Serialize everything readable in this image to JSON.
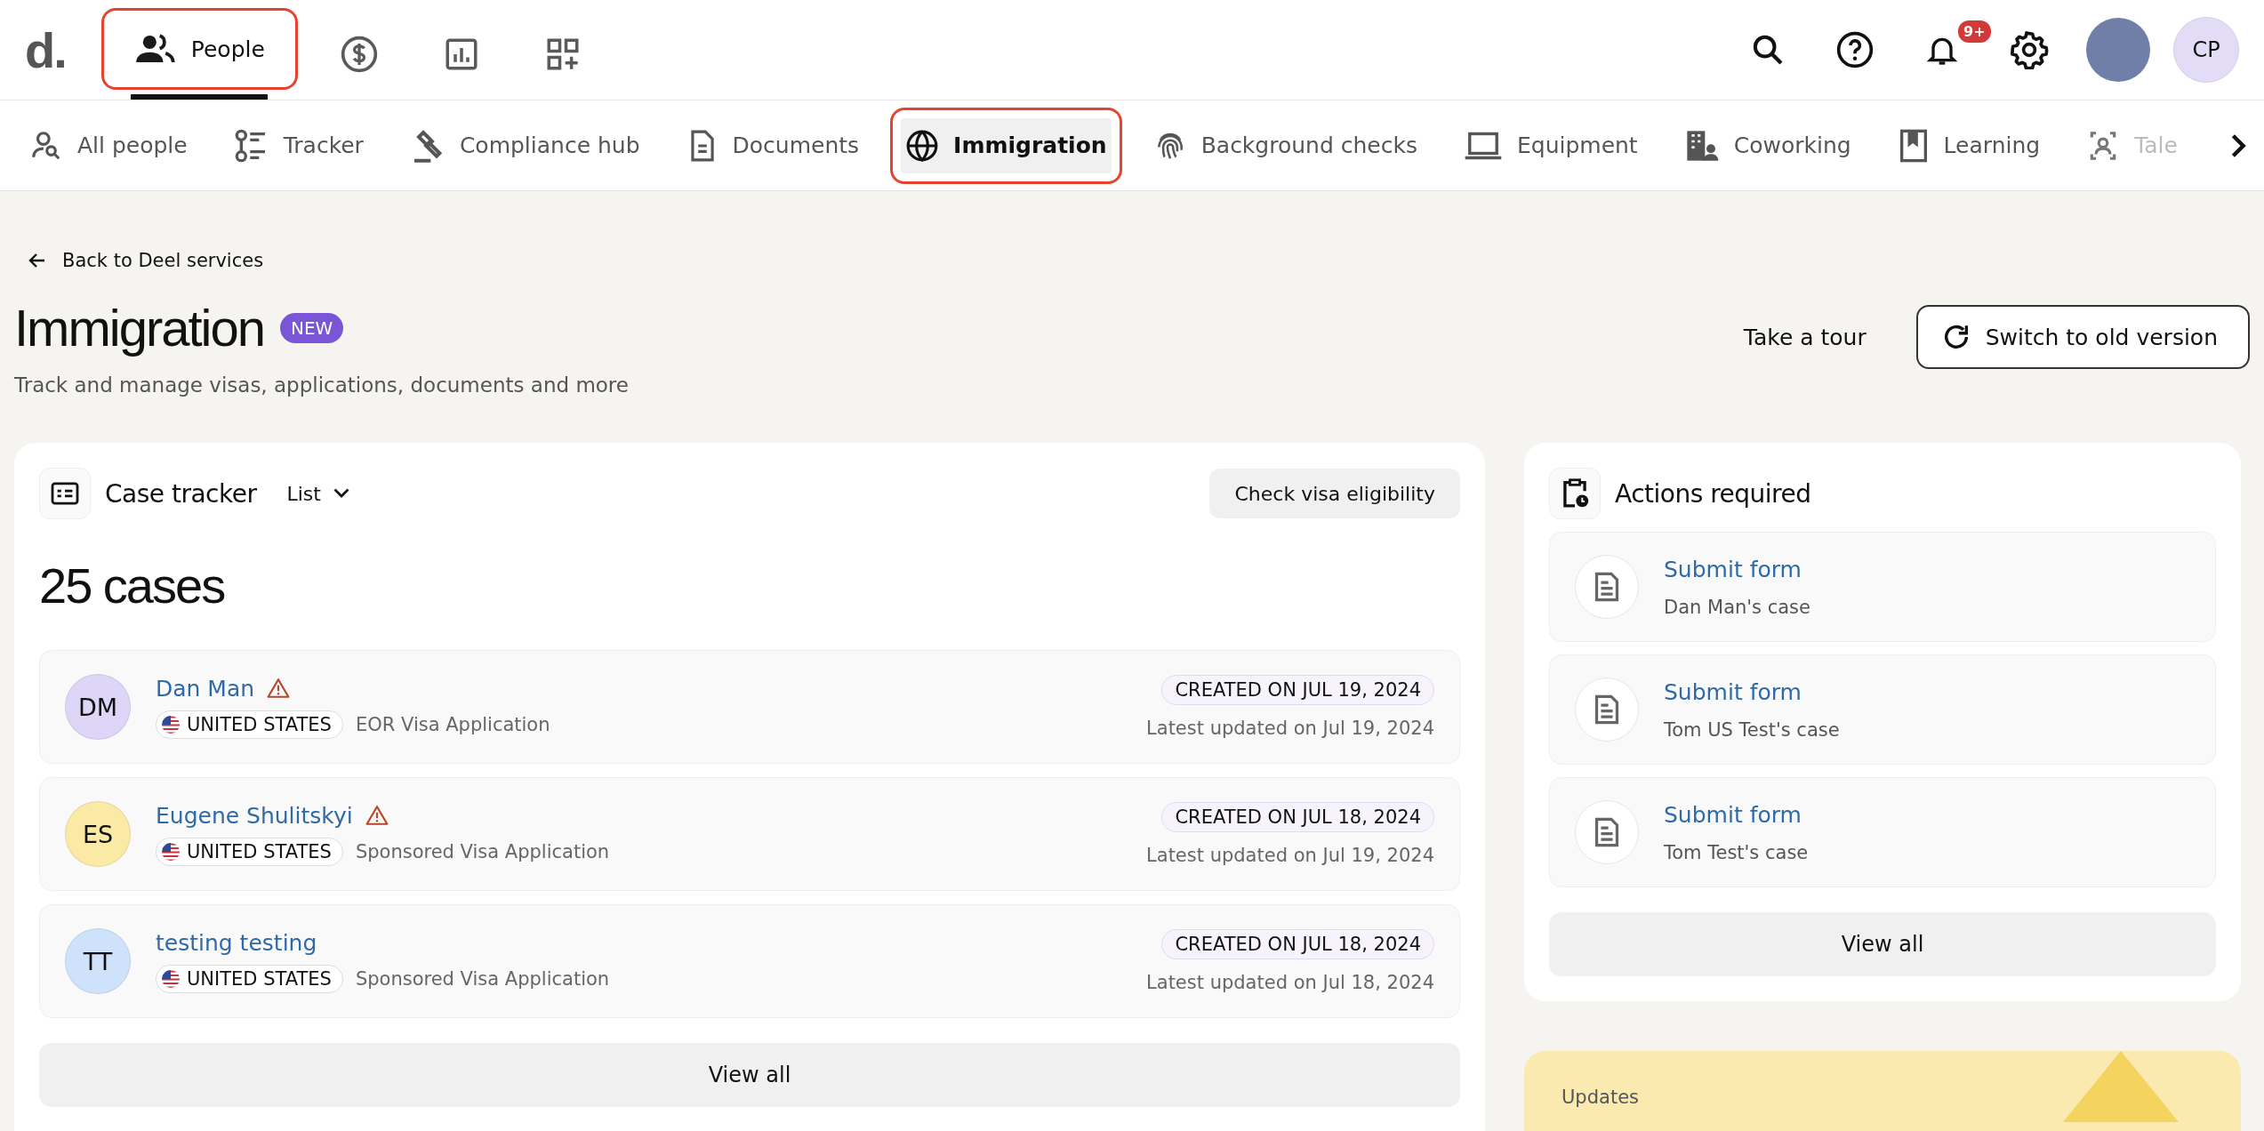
{
  "topbar": {
    "logo": "d.",
    "nav": [
      {
        "kind": "people",
        "label": "People",
        "selected": true,
        "highlighted": true
      },
      {
        "kind": "money",
        "selected": false,
        "highlighted": false
      },
      {
        "kind": "reports",
        "selected": false,
        "highlighted": false
      },
      {
        "kind": "apps",
        "selected": false,
        "highlighted": false
      }
    ],
    "notification_badge": "9+",
    "user_initials": "CP"
  },
  "tabs": [
    {
      "kind": "people-search",
      "label": "All people",
      "selected": false,
      "highlighted": false
    },
    {
      "kind": "tracker",
      "label": "Tracker",
      "selected": false,
      "highlighted": false
    },
    {
      "kind": "gavel",
      "label": "Compliance hub",
      "selected": false,
      "highlighted": false
    },
    {
      "kind": "document",
      "label": "Documents",
      "selected": false,
      "highlighted": false
    },
    {
      "kind": "globe",
      "label": "Immigration",
      "selected": true,
      "highlighted": true
    },
    {
      "kind": "fingerprint",
      "label": "Background checks",
      "selected": false,
      "highlighted": false
    },
    {
      "kind": "laptop",
      "label": "Equipment",
      "selected": false,
      "highlighted": false
    },
    {
      "kind": "building",
      "label": "Coworking",
      "selected": false,
      "highlighted": false
    },
    {
      "kind": "book",
      "label": "Learning",
      "selected": false,
      "highlighted": false
    },
    {
      "kind": "talent",
      "label": "Tale",
      "selected": false,
      "highlighted": false,
      "faded": true
    }
  ],
  "back_link": "Back to Deel services",
  "page": {
    "title": "Immigration",
    "badge": "NEW",
    "subtitle": "Track and manage visas, applications, documents and more",
    "tour_link": "Take a tour",
    "switch_button": "Switch to old version"
  },
  "case_tracker": {
    "title": "Case tracker",
    "view_select": "List",
    "check_button": "Check visa eligibility",
    "count": "25 cases",
    "cases": [
      {
        "initials": "DM",
        "color": "#ddd6f7",
        "name": "Dan Man",
        "warning": true,
        "country": "UNITED STATES",
        "type": "EOR Visa Application",
        "created": "CREATED ON JUL 19, 2024",
        "updated": "Latest updated on Jul 19, 2024"
      },
      {
        "initials": "ES",
        "color": "#fbe9a6",
        "name": "Eugene Shulitskyi",
        "warning": true,
        "country": "UNITED STATES",
        "type": "Sponsored Visa Application",
        "created": "CREATED ON JUL 18, 2024",
        "updated": "Latest updated on Jul 19, 2024"
      },
      {
        "initials": "TT",
        "color": "#cfe2fb",
        "name": "testing testing",
        "warning": false,
        "country": "UNITED STATES",
        "type": "Sponsored Visa Application",
        "created": "CREATED ON JUL 18, 2024",
        "updated": "Latest updated on Jul 18, 2024"
      }
    ],
    "view_all": "View all"
  },
  "actions": {
    "title": "Actions required",
    "items": [
      {
        "action": "Submit form",
        "case": "Dan Man's case"
      },
      {
        "action": "Submit form",
        "case": "Tom US Test's case"
      },
      {
        "action": "Submit form",
        "case": "Tom Test's case"
      }
    ],
    "view_all": "View all"
  },
  "updates": {
    "label": "Updates"
  }
}
